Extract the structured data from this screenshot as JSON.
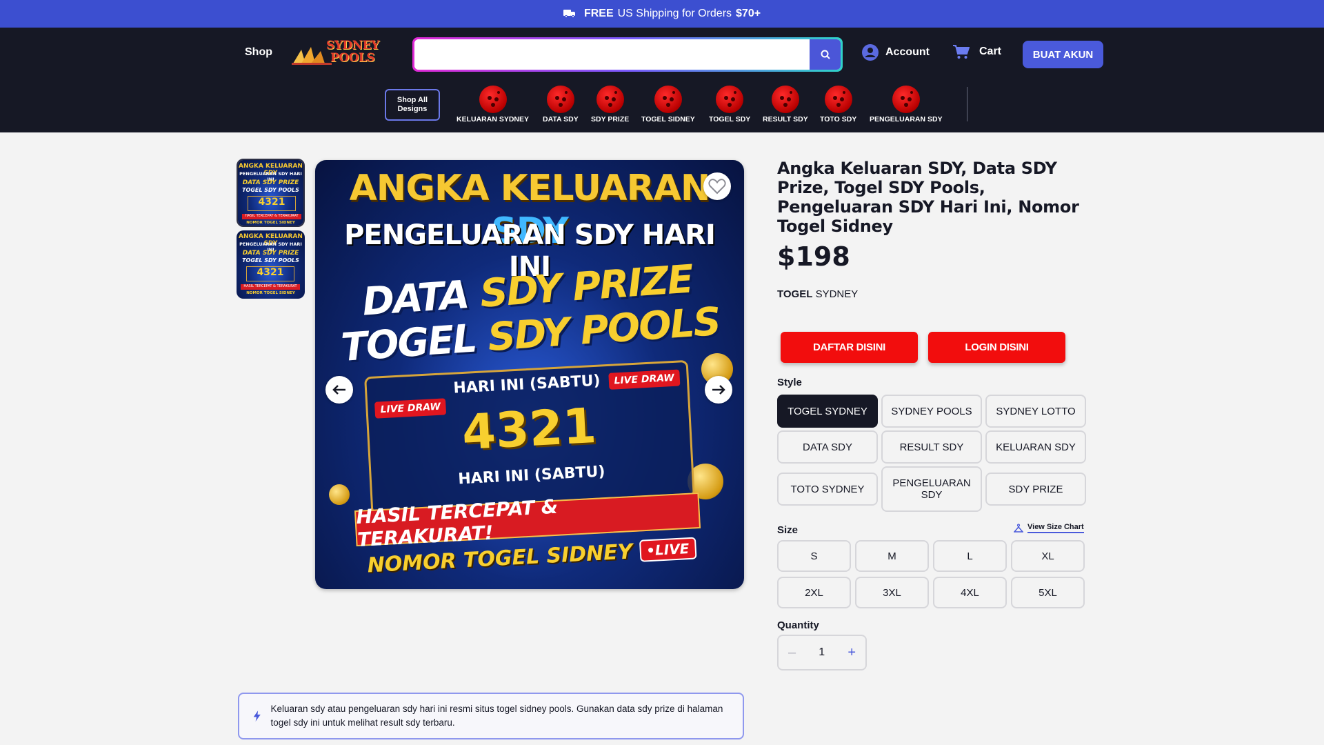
{
  "promo": {
    "free": "FREE",
    "text": "US Shipping for Orders",
    "amount": "$70+"
  },
  "header": {
    "shop": "Shop",
    "logo_line1": "SYDNEY",
    "logo_line2": "POOLS",
    "search_placeholder": "",
    "account": "Account",
    "cart": "Cart",
    "cta": "BUAT AKUN"
  },
  "categories": {
    "shop_all_line1": "Shop All",
    "shop_all_line2": "Designs",
    "items": [
      "KELUARAN SYDNEY",
      "DATA SDY",
      "SDY PRIZE",
      "TOGEL SIDNEY",
      "TOGEL SDY",
      "RESULT SDY",
      "TOTO SDY",
      "PENGELUARAN SDY"
    ]
  },
  "banner": {
    "line1": "ANGKA KELUARAN ",
    "line1_accent": "SDY",
    "line2": "PENGELUARAN SDY HARI INI",
    "line3_a": "DATA ",
    "line3_b": "SDY PRIZE",
    "line4_a": "TOGEL ",
    "line4_b": "SDY POOLS",
    "live_draw": "LIVE DRAW",
    "hari_ini": "HARI INI (SABTU)",
    "number": "4321",
    "hasil": "HASIL TERCEPAT & TERAKURAT!",
    "nomor": "NOMOR TOGEL SIDNEY",
    "live": "•LIVE",
    "thumb_line1": "ANGKA KELUARAN SDY",
    "thumb_line2": "PENGELUARAN SDY HARI INI",
    "thumb_line3": "DATA SDY PRIZE",
    "thumb_line4": "TOGEL SDY POOLS",
    "thumb_line5": "HASIL TERCEPAT & TERAKURAT",
    "thumb_line6": "NOMOR TOGEL SIDNEY"
  },
  "product": {
    "title": "Angka Keluaran SDY, Data SDY Prize, Togel SDY Pools, Pengeluaran SDY Hari Ini, Nomor Togel Sidney",
    "price": "$198",
    "vendor_bold": "TOGEL",
    "vendor_rest": " SYDNEY",
    "btn_daftar": "DAFTAR DISINI",
    "btn_login": "LOGIN DISINI",
    "style_label": "Style",
    "styles": [
      "TOGEL SYDNEY",
      "SYDNEY POOLS",
      "SYDNEY LOTTO",
      "DATA SDY",
      "RESULT SDY",
      "KELUARAN SDY",
      "TOTO SYDNEY",
      "PENGELUARAN SDY",
      "SDY PRIZE"
    ],
    "selected_style": "TOGEL SYDNEY",
    "size_label": "Size",
    "size_chart": "View Size Chart",
    "sizes": [
      "S",
      "M",
      "L",
      "XL",
      "2XL",
      "3XL",
      "4XL",
      "5XL"
    ],
    "quantity_label": "Quantity",
    "quantity_minus": "–",
    "quantity": "1",
    "quantity_plus": "+"
  },
  "info": {
    "text": "Keluaran sdy atau pengeluaran sdy hari ini resmi situs togel sidney pools. Gunakan data sdy prize di halaman togel sdy ini untuk melihat result sdy terbaru."
  },
  "colors": {
    "promo_bg": "#3c4fd0",
    "header_bg": "#161825",
    "accent": "#4a5adb",
    "cta_red": "#f20d0d"
  },
  "icons": [
    "truck-icon",
    "search-icon",
    "user-icon",
    "cart-icon",
    "heart-icon",
    "arrow-left-icon",
    "arrow-right-icon",
    "hanger-icon",
    "lightning-icon"
  ]
}
